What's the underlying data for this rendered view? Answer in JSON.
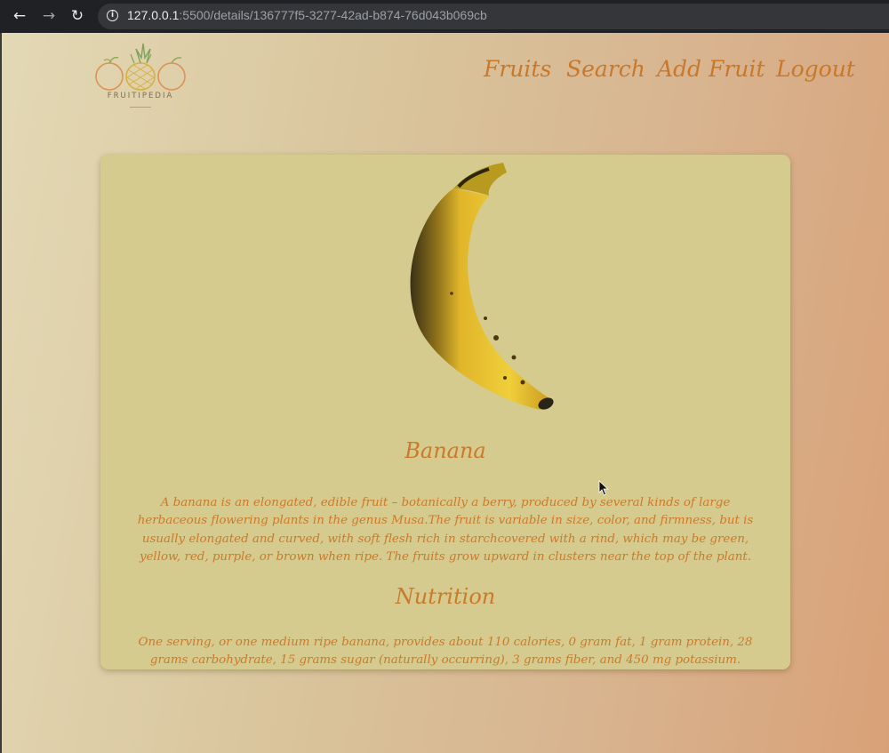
{
  "browser": {
    "url_host": "127.0.0.1",
    "url_path": ":5500/details/136777f5-3277-42ad-b874-76d043b069cb"
  },
  "logo": {
    "text": "FRUITIPEDIA"
  },
  "nav": {
    "fruits": "Fruits",
    "search": "Search",
    "add_fruit": "Add Fruit",
    "logout": "Logout"
  },
  "fruit": {
    "name": "Banana",
    "description": "A banana is an elongated, edible fruit – botanically a berry, produced by several kinds of large herbaceous flowering plants in the genus Musa.The fruit is variable in size, color, and firmness, but is usually elongated and curved, with soft flesh rich in starchcovered with a rind, which may be green, yellow, red, purple, or brown when ripe. The fruits grow upward in clusters near the top of the plant.",
    "nutrition_title": "Nutrition",
    "nutrition": "One serving, or one medium ripe banana, provides about 110 calories, 0 gram fat, 1 gram protein, 28 grams carbohydrate, 15 grams sugar (naturally occurring), 3 grams fiber, and 450 mg potassium."
  },
  "colors": {
    "accent": "#cc7a2a",
    "card": "#d5cb8e"
  }
}
